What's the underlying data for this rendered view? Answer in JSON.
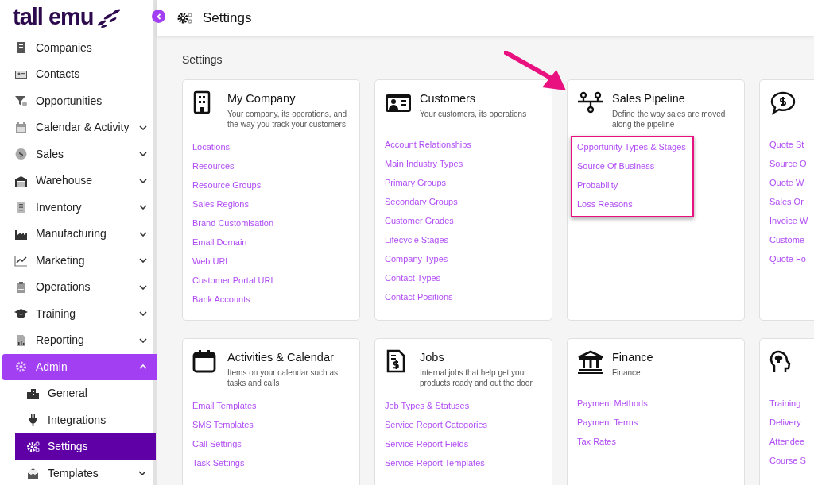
{
  "logo": "tall emu",
  "sidebar": {
    "items": [
      {
        "label": "Companies",
        "expandable": false,
        "selected": false
      },
      {
        "label": "Contacts",
        "expandable": false,
        "selected": false
      },
      {
        "label": "Opportunities",
        "expandable": false,
        "selected": false
      },
      {
        "label": "Calendar & Activity",
        "expandable": true,
        "expanded": false,
        "selected": false
      },
      {
        "label": "Sales",
        "expandable": true,
        "expanded": false,
        "selected": false
      },
      {
        "label": "Warehouse",
        "expandable": true,
        "expanded": false,
        "selected": false
      },
      {
        "label": "Inventory",
        "expandable": true,
        "expanded": false,
        "selected": false
      },
      {
        "label": "Manufacturing",
        "expandable": true,
        "expanded": false,
        "selected": false
      },
      {
        "label": "Marketing",
        "expandable": true,
        "expanded": false,
        "selected": false
      },
      {
        "label": "Operations",
        "expandable": true,
        "expanded": false,
        "selected": false
      },
      {
        "label": "Training",
        "expandable": true,
        "expanded": false,
        "selected": false
      },
      {
        "label": "Reporting",
        "expandable": true,
        "expanded": false,
        "selected": false
      },
      {
        "label": "Admin",
        "expandable": true,
        "expanded": true,
        "selected": true,
        "children": [
          {
            "label": "General",
            "expandable": false,
            "selected": false
          },
          {
            "label": "Integrations",
            "expandable": false,
            "selected": false
          },
          {
            "label": "Settings",
            "expandable": false,
            "selected": true
          },
          {
            "label": "Templates",
            "expandable": true,
            "expanded": false,
            "selected": false
          }
        ]
      }
    ]
  },
  "header": {
    "title": "Settings"
  },
  "page_heading": "Settings",
  "cards": [
    {
      "title": "My Company",
      "description": [
        "Your company, its operations, and",
        "the way you track your customers"
      ],
      "highlighted": false,
      "links": [
        "Locations",
        "Resources",
        "Resource Groups",
        "Sales Regions",
        "Brand Customisation",
        "Email Domain",
        "Web URL",
        "Customer Portal URL",
        "Bank Accounts"
      ]
    },
    {
      "title": "Customers",
      "description": [
        "Your customers, its operations"
      ],
      "highlighted": false,
      "links": [
        "Account Relationships",
        "Main Industry Types",
        "Primary Groups",
        "Secondary Groups",
        "Customer Grades",
        "Lifecycle Stages",
        "Company Types",
        "Contact Types",
        "Contact Positions"
      ]
    },
    {
      "title": "Sales Pipeline",
      "description": [
        "Define the way sales are moved",
        "along the pipeline"
      ],
      "highlighted": true,
      "links": [
        "Opportunity Types & Stages",
        "Source Of Business",
        "Probability",
        "Loss Reasons"
      ]
    },
    {
      "highlighted": false,
      "links": [
        "Quote St",
        "Source O",
        "Quote W",
        "Sales Or",
        "Invoice W",
        "Custome",
        "Quote Fo"
      ]
    },
    {
      "title": "Activities & Calendar",
      "description": [
        "Items on your calendar such as",
        "tasks and calls"
      ],
      "highlighted": false,
      "links": [
        "Email Templates",
        "SMS Templates",
        "Call Settings",
        "Task Settings"
      ]
    },
    {
      "title": "Jobs",
      "description": [
        "Internal jobs that help get your",
        "products ready and out the door"
      ],
      "highlighted": false,
      "links": [
        "Job Types & Statuses",
        "Service Report Categories",
        "Service Report Fields",
        "Service Report Templates"
      ]
    },
    {
      "title": "Finance",
      "description": [
        "Finance"
      ],
      "highlighted": false,
      "links": [
        "Payment Methods",
        "Payment Terms",
        "Tax Rates"
      ]
    },
    {
      "highlighted": false,
      "links": [
        "Training",
        "Delivery",
        "Attendee",
        "Course S"
      ]
    }
  ]
}
